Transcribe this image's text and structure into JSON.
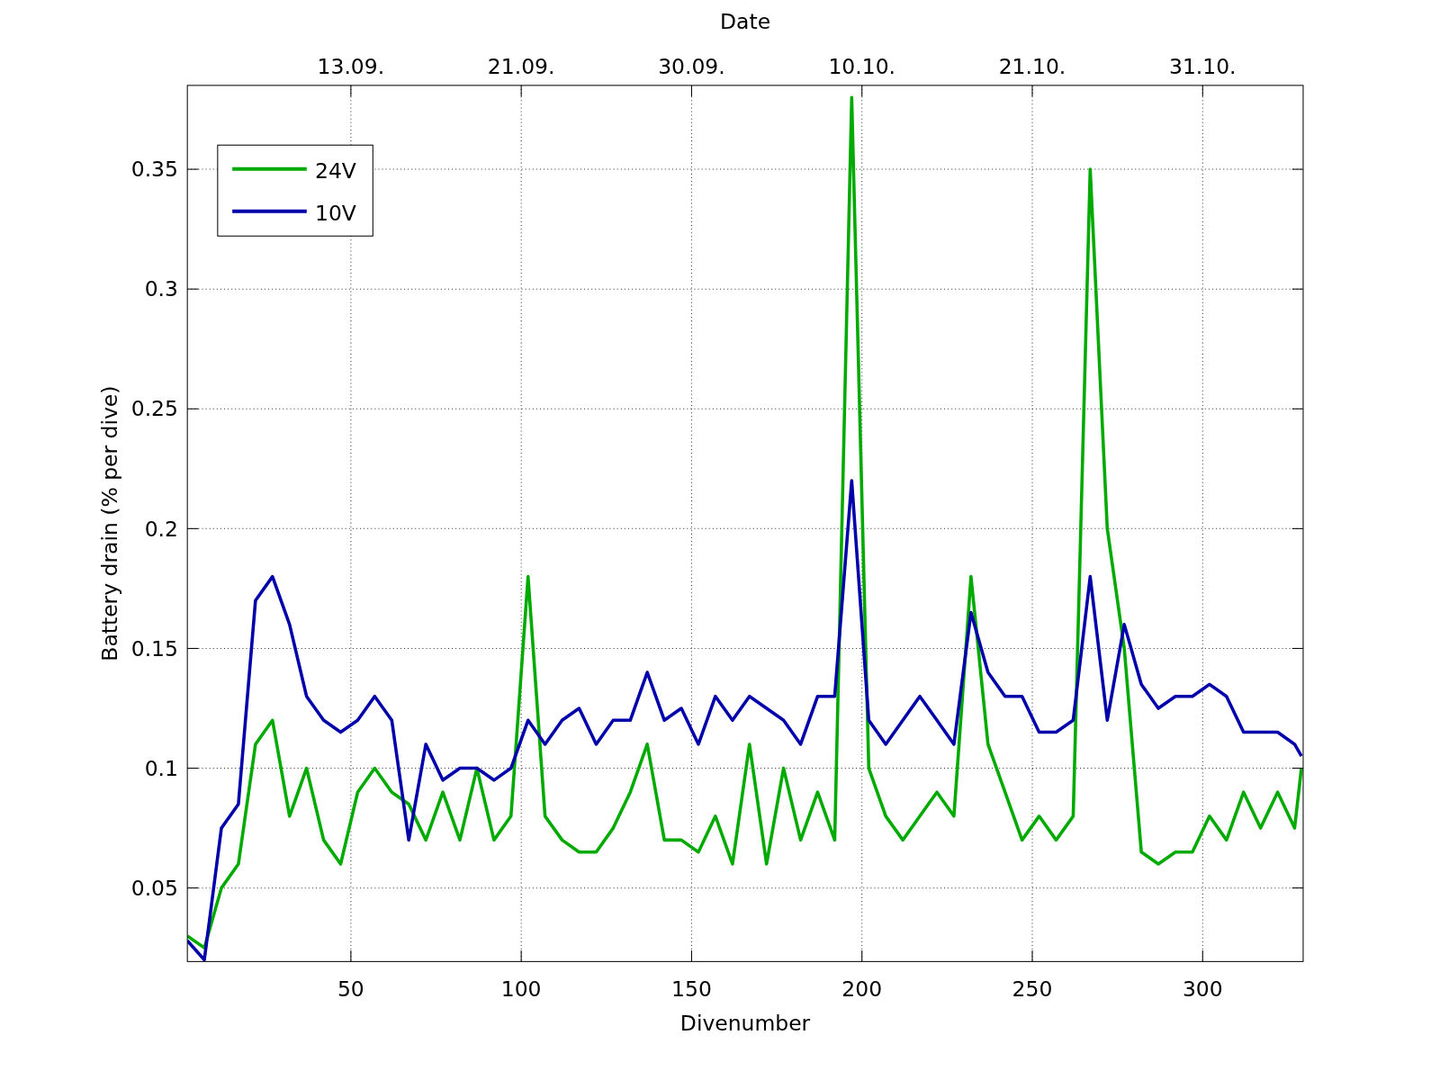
{
  "figure": {
    "top_axis": {
      "label": "Date",
      "ticks": [
        "13.09.",
        "21.09.",
        "30.09.",
        "10.10.",
        "21.10.",
        "31.10."
      ]
    },
    "chart_data": {
      "type": "line",
      "xlabel": "Divenumber",
      "ylabel": "Battery drain (% per dive)",
      "grid": true,
      "legend": true,
      "xlim": [
        2,
        329.5
      ],
      "ylim": [
        0.0193,
        0.385
      ],
      "xticks": [
        50,
        100,
        150,
        200,
        250,
        300
      ],
      "yticks": [
        0.05,
        0.1,
        0.15,
        0.2,
        0.25,
        0.3,
        0.35
      ],
      "x": [
        2,
        7,
        12,
        17,
        22,
        27,
        32,
        37,
        42,
        47,
        52,
        57,
        62,
        67,
        72,
        77,
        82,
        87,
        92,
        97,
        102,
        107,
        112,
        117,
        122,
        127,
        132,
        137,
        142,
        147,
        152,
        157,
        162,
        167,
        172,
        177,
        182,
        187,
        192,
        197,
        202,
        207,
        212,
        217,
        222,
        227,
        232,
        237,
        242,
        247,
        252,
        257,
        262,
        267,
        272,
        277,
        282,
        287,
        292,
        297,
        302,
        307,
        312,
        317,
        322,
        327,
        329
      ],
      "series": [
        {
          "name": "24V",
          "color": "#00aa00",
          "values": [
            0.03,
            0.025,
            0.05,
            0.06,
            0.11,
            0.12,
            0.08,
            0.1,
            0.07,
            0.06,
            0.09,
            0.1,
            0.09,
            0.085,
            0.07,
            0.09,
            0.07,
            0.1,
            0.07,
            0.08,
            0.18,
            0.08,
            0.07,
            0.065,
            0.065,
            0.075,
            0.09,
            0.11,
            0.07,
            0.07,
            0.065,
            0.08,
            0.06,
            0.11,
            0.06,
            0.1,
            0.07,
            0.09,
            0.07,
            0.38,
            0.1,
            0.08,
            0.07,
            0.08,
            0.09,
            0.08,
            0.18,
            0.11,
            0.09,
            0.07,
            0.08,
            0.07,
            0.08,
            0.35,
            0.2,
            0.15,
            0.065,
            0.06,
            0.065,
            0.065,
            0.08,
            0.07,
            0.09,
            0.075,
            0.09,
            0.075,
            0.1
          ]
        },
        {
          "name": "10V",
          "color": "#0000aa",
          "values": [
            0.028,
            0.02,
            0.075,
            0.085,
            0.17,
            0.18,
            0.16,
            0.13,
            0.12,
            0.115,
            0.12,
            0.13,
            0.12,
            0.07,
            0.11,
            0.095,
            0.1,
            0.1,
            0.095,
            0.1,
            0.12,
            0.11,
            0.12,
            0.125,
            0.11,
            0.12,
            0.12,
            0.14,
            0.12,
            0.125,
            0.11,
            0.13,
            0.12,
            0.13,
            0.125,
            0.12,
            0.11,
            0.13,
            0.13,
            0.22,
            0.12,
            0.11,
            0.12,
            0.13,
            0.12,
            0.11,
            0.165,
            0.14,
            0.13,
            0.13,
            0.115,
            0.115,
            0.12,
            0.18,
            0.12,
            0.16,
            0.135,
            0.125,
            0.13,
            0.13,
            0.135,
            0.13,
            0.115,
            0.115,
            0.115,
            0.11,
            0.105
          ]
        }
      ]
    }
  }
}
